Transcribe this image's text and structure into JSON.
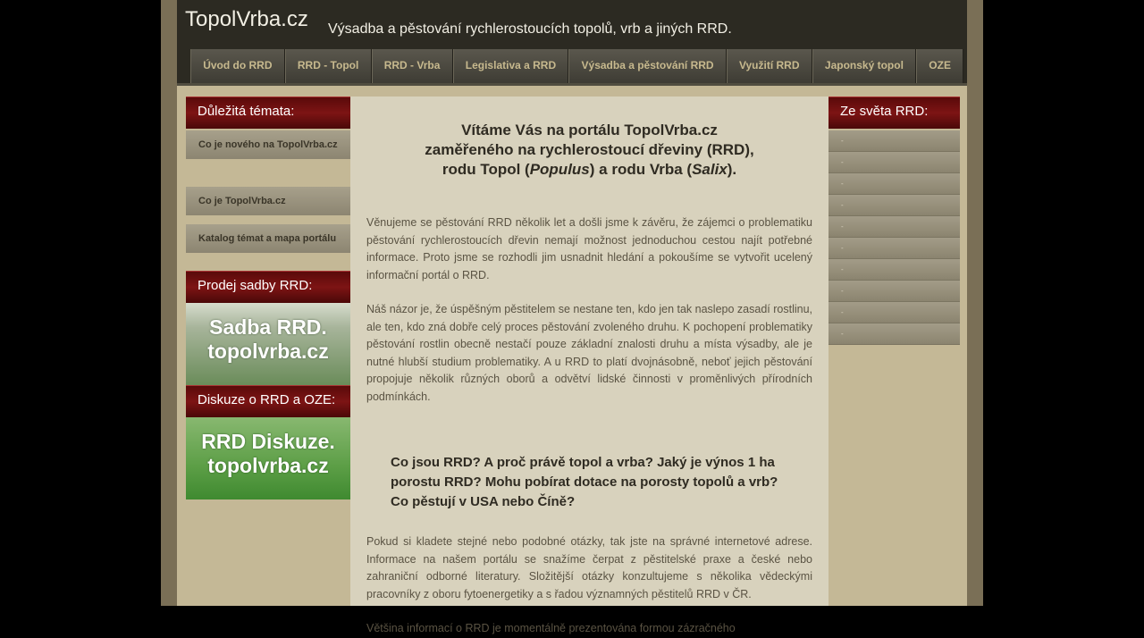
{
  "header": {
    "logo": "TopolVrba.cz",
    "tagline": "Výsadba a pěstování rychlerostoucích topolů, vrb a jiných RRD."
  },
  "nav": [
    {
      "label": "Úvod do RRD"
    },
    {
      "label": "RRD - Topol"
    },
    {
      "label": "RRD - Vrba"
    },
    {
      "label": "Legislativa a RRD"
    },
    {
      "label": "Výsadba a pěstování RRD"
    },
    {
      "label": "Využití RRD"
    },
    {
      "label": "Japonský topol"
    },
    {
      "label": "OZE"
    }
  ],
  "left": {
    "topics_title": "Důležitá témata:",
    "topics": [
      "Co je nového na TopolVrba.cz",
      "Co je TopolVrba.cz",
      "Katalog témat a mapa portálu"
    ],
    "sale_title": "Prodej sadby RRD:",
    "sale_banner": [
      "Sadba RRD.",
      "topolvrba.cz"
    ],
    "forum_title": "Diskuze o RRD a OZE:",
    "forum_banner": [
      "RRD Diskuze.",
      "topolvrba.cz"
    ]
  },
  "right": {
    "title": "Ze světa RRD:",
    "items": [
      "-",
      "-",
      "-",
      "-",
      "-",
      "-",
      "-",
      "-",
      "-",
      "-"
    ]
  },
  "content": {
    "welcome_line1": "Vítáme Vás na portálu TopolVrba.cz",
    "welcome_line2": "zaměřeného na rychlerostoucí dřeviny (RRD),",
    "welcome_line3_a": "rodu Topol (",
    "welcome_line3_b": "Populus",
    "welcome_line3_c": ") a rodu Vrba (",
    "welcome_line3_d": "Salix",
    "welcome_line3_e": ").",
    "para1": "Věnujeme se pěstování RRD několik let a došli jsme k závěru, že zájemci o problematiku pěstování rychlerostoucích dřevin nemají možnost jednoduchou cestou najít potřebné informace. Proto jsme se rozhodli jim usnadnit hledání a pokoušíme se vytvořit ucelený informační portál o RRD.",
    "para2": "Náš názor je, že úspěšným pěstitelem se nestane ten, kdo jen tak naslepo zasadí rostlinu, ale ten, kdo zná dobře celý proces pěstování zvoleného druhu. K pochopení problematiky pěstování rostlin obecně nestačí pouze základní znalosti druhu a místa výsadby, ale je nutné hlubší studium problematiky. A u RRD to platí dvojnásobně, neboť jejich pěstování propojuje několik různých oborů a odvětví lidské činnosti v proměnlivých přírodních podmínkách.",
    "subhead": "Co jsou RRD? A proč právě topol a vrba? Jaký je výnos 1 ha porostu RRD? Mohu pobírat dotace na porosty topolů a vrb? Co pěstují v USA nebo Číně?",
    "para3": "Pokud si kladete stejné nebo podobné otázky, tak jste na správné internetové adrese. Informace na našem portálu se snažíme čerpat z pěstitelské praxe a české nebo zahraniční odborné literatury. Složitější otázky konzultujeme s několika vědeckými pracovníky z oboru fytoenergetiky a s řadou významných pěstitelů RRD v ČR.",
    "para4": "Většina informací o RRD je momentálně prezentována formou zázračného"
  },
  "colors": {
    "header_bg": "#2c2a22",
    "nav_text": "#c7b98e",
    "box_header_red": "#7d1414",
    "content_bg": "#d8d2bd",
    "page_bg": "#c4b896"
  }
}
